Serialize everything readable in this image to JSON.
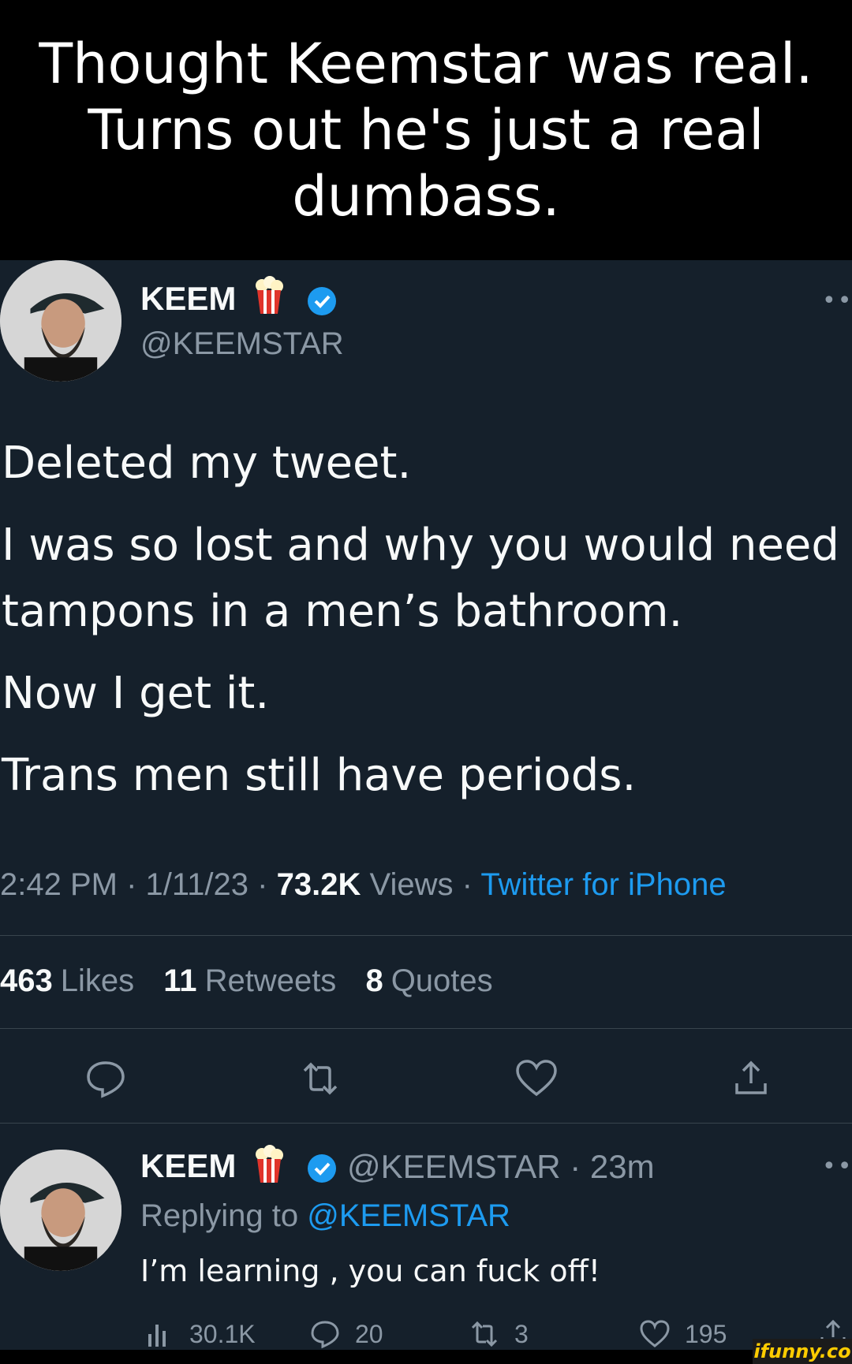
{
  "caption": {
    "lines": [
      "Thought Keemstar was real.",
      "Turns out he's just a real",
      "dumbass."
    ]
  },
  "tweet": {
    "author_name": "KEEM",
    "author_handle": "@KEEMSTAR",
    "more_label": "•••",
    "lines": [
      "Deleted my tweet.",
      "I was so lost and why you would need",
      "tampons in a men’s bathroom.",
      "Now I get it.",
      "Trans men still have periods."
    ],
    "time": "2:42 PM",
    "date": "1/11/23",
    "views_count": "73.2K",
    "views_label": "Views",
    "source": "Twitter for iPhone",
    "separator": "·",
    "likes_count": "463",
    "likes_label": "Likes",
    "retweets_count": "11",
    "retweets_label": "Retweets",
    "quotes_count": "8",
    "quotes_label": "Quotes",
    "icons": [
      "reply-icon",
      "retweet-icon",
      "like-icon",
      "share-icon"
    ]
  },
  "reply": {
    "author_name": "KEEM",
    "author_handle": "@KEEMSTAR",
    "age": "23m",
    "replying_prefix": "Replying to",
    "replying_to": "@KEEMSTAR",
    "text": "I’m learning , you can fuck off!",
    "more_label": "•••",
    "views": "30.1K",
    "replies": "20",
    "retweets": "3",
    "likes": "195"
  },
  "watermark": "ifunny.co",
  "colors": {
    "background": "#15202b",
    "text": "#f7f9f9",
    "muted": "#8b98a5",
    "accent": "#1d9bf0",
    "divider": "#38444d"
  }
}
